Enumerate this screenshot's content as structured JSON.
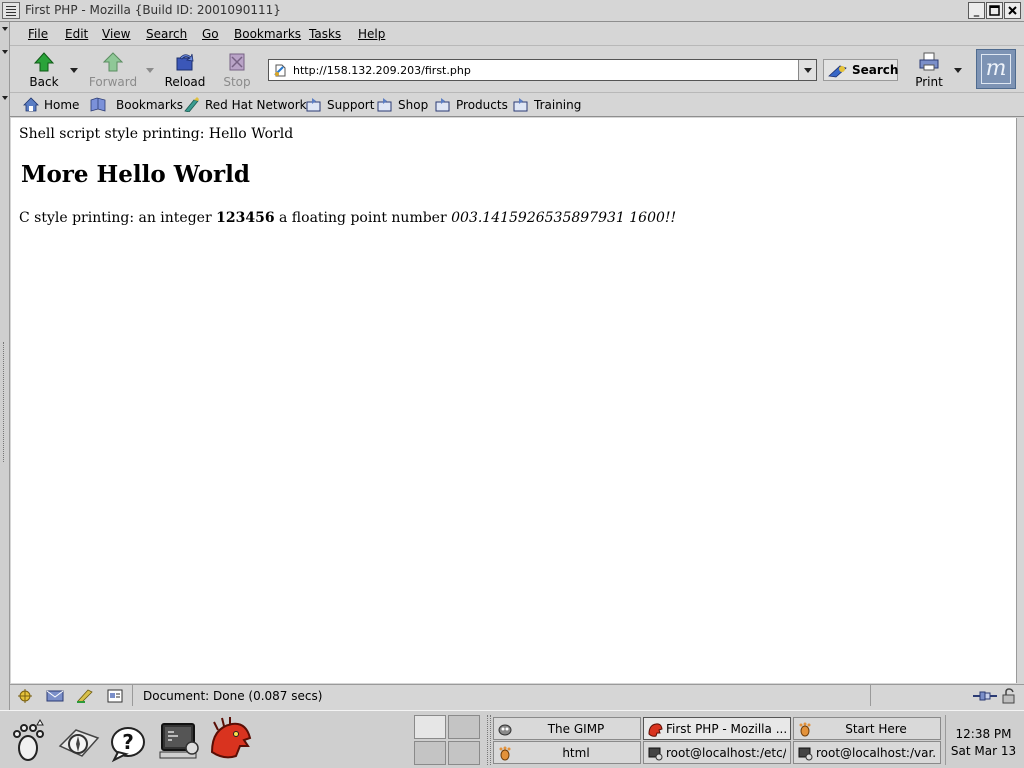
{
  "window": {
    "title": "First PHP - Mozilla {Build ID: 2001090111}"
  },
  "menubar": {
    "items": [
      {
        "label": "File"
      },
      {
        "label": "Edit"
      },
      {
        "label": "View"
      },
      {
        "label": "Search"
      },
      {
        "label": "Go"
      },
      {
        "label": "Bookmarks"
      },
      {
        "label": "Tasks"
      },
      {
        "label": "Help"
      }
    ]
  },
  "navbar": {
    "back_label": "Back",
    "forward_label": "Forward",
    "reload_label": "Reload",
    "stop_label": "Stop",
    "url": "http://158.132.209.203/first.php",
    "search_label": "Search",
    "print_label": "Print"
  },
  "personal_toolbar": {
    "items": [
      {
        "label": "Home"
      },
      {
        "label": "Bookmarks"
      },
      {
        "label": "Red Hat Network"
      },
      {
        "label": "Support"
      },
      {
        "label": "Shop"
      },
      {
        "label": "Products"
      },
      {
        "label": "Training"
      }
    ]
  },
  "content": {
    "line1": "Shell script style printing: Hello World",
    "heading": "More Hello World",
    "line2_prefix": "C style printing: an integer ",
    "line2_integer": "123456",
    "line2_middle": " a floating point number ",
    "line2_float": "003.1415926535897931 1600!!"
  },
  "statusbar": {
    "message": "Document: Done (0.087 secs)"
  },
  "taskbar": {
    "tasks": [
      {
        "label": "The GIMP"
      },
      {
        "label": "First PHP - Mozilla ..."
      },
      {
        "label": "Start Here"
      },
      {
        "label": "html"
      },
      {
        "label": "root@localhost:/etc/..."
      },
      {
        "label": "root@localhost:/var..."
      }
    ],
    "clock_time": "12:38 PM",
    "clock_date": "Sat Mar 13"
  }
}
